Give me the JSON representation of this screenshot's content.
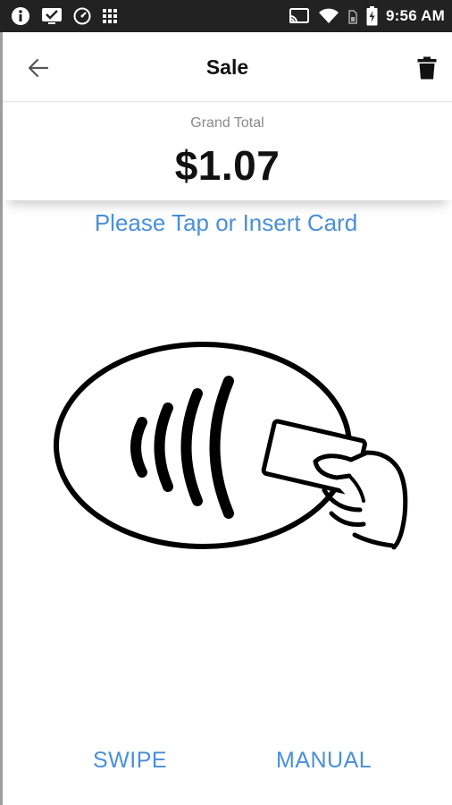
{
  "status_bar": {
    "time": "9:56 AM",
    "icons": [
      "info-icon",
      "checkbox-icon",
      "speedometer-icon",
      "grid-icon",
      "cast-icon",
      "wifi-icon",
      "sim-icon",
      "battery-charging-icon"
    ]
  },
  "app_bar": {
    "title": "Sale",
    "back_icon": "arrow-left-icon",
    "delete_icon": "trash-icon"
  },
  "total": {
    "label": "Grand Total",
    "amount": "$1.07"
  },
  "prompt": "Please Tap or Insert Card",
  "illustration": "contactless-card-tap",
  "actions": {
    "swipe": "SWIPE",
    "manual": "MANUAL"
  },
  "colors": {
    "accent": "#4a8fd9",
    "status_bar": "#222222",
    "text": "#111111"
  }
}
